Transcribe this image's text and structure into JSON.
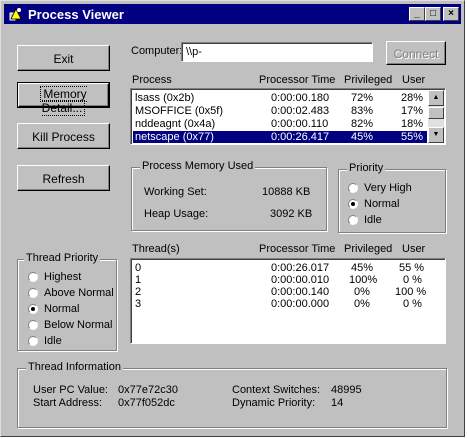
{
  "window": {
    "title": "Process Viewer",
    "controls": [
      "_",
      "□",
      "×"
    ]
  },
  "buttons": {
    "exit": "Exit",
    "memory_detail": "Memory Detail...",
    "kill_process": "Kill Process",
    "refresh": "Refresh",
    "connect": "Connect"
  },
  "computer": {
    "label": "Computer:",
    "value": "\\\\p-"
  },
  "process_list": {
    "headers": [
      "Process",
      "Processor Time",
      "Privileged",
      "User"
    ],
    "rows": [
      {
        "name": "lsass (0x2b)",
        "time": "0:00:00.180",
        "priv": "72%",
        "user": "28%"
      },
      {
        "name": "MSOFFICE (0x5f)",
        "time": "0:00:02.483",
        "priv": "83%",
        "user": "17%"
      },
      {
        "name": "nddeagnt (0x4a)",
        "time": "0:00:00.110",
        "priv": "82%",
        "user": "18%"
      },
      {
        "name": "netscape (0x77)",
        "time": "0:00:26.417",
        "priv": "45%",
        "user": "55%"
      }
    ],
    "selected_index": 3
  },
  "memory": {
    "legend": "Process Memory Used",
    "working_set_label": "Working Set:",
    "working_set_value": "10888 KB",
    "heap_usage_label": "Heap Usage:",
    "heap_usage_value": "3092 KB"
  },
  "priority": {
    "legend": "Priority",
    "options": [
      "Very High",
      "Normal",
      "Idle"
    ],
    "selected": "Normal"
  },
  "thread_priority": {
    "legend": "Thread Priority",
    "options": [
      "Highest",
      "Above Normal",
      "Normal",
      "Below Normal",
      "Idle"
    ],
    "selected": "Normal"
  },
  "threads": {
    "headers": [
      "Thread(s)",
      "Processor Time",
      "Privileged",
      "User"
    ],
    "rows": [
      {
        "id": "0",
        "time": "0:00:26.017",
        "priv": "45%",
        "user": "55 %"
      },
      {
        "id": "1",
        "time": "0:00:00.010",
        "priv": "100%",
        "user": "0 %"
      },
      {
        "id": "2",
        "time": "0:00:00.140",
        "priv": "0%",
        "user": "100 %"
      },
      {
        "id": "3",
        "time": "0:00:00.000",
        "priv": "0%",
        "user": "0 %"
      }
    ]
  },
  "thread_info": {
    "legend": "Thread Information",
    "user_pc_label": "User PC Value:",
    "user_pc_value": "0x77e72c30",
    "start_address_label": "Start Address:",
    "start_address_value": "0x77f052dc",
    "context_switches_label": "Context Switches:",
    "context_switches_value": "48995",
    "dynamic_priority_label": "Dynamic Priority:",
    "dynamic_priority_value": "14"
  }
}
